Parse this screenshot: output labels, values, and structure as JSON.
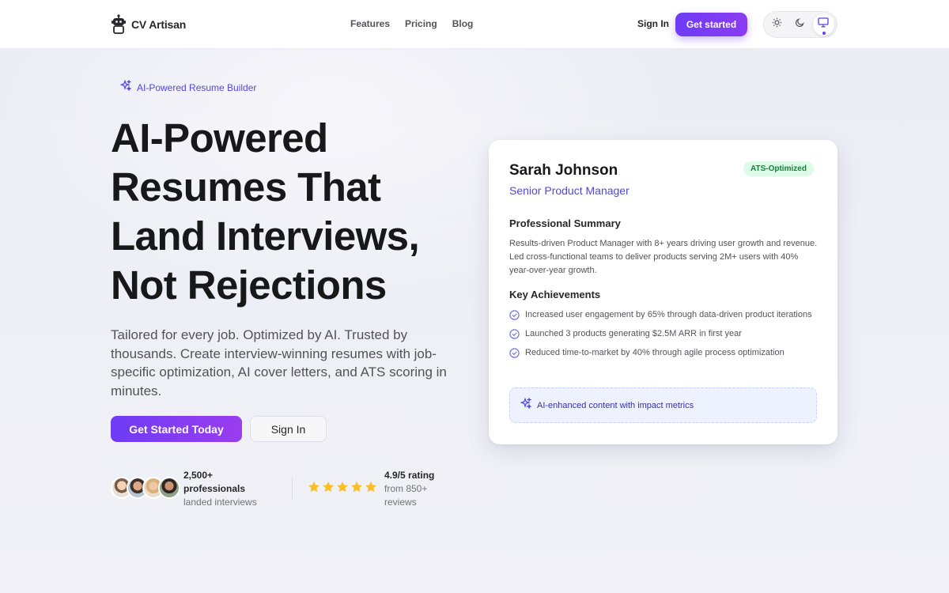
{
  "nav": {
    "logo_text": "CV Artisan",
    "links": [
      "Features",
      "Pricing",
      "Blog"
    ],
    "sign_in": "Sign In",
    "cta": "Get started",
    "theme_options": [
      "light",
      "dark",
      "system"
    ],
    "theme_selected": "system"
  },
  "hero": {
    "badge": "AI-Powered Resume Builder",
    "headline_lines": [
      "AI-Powered",
      "Resumes That",
      "Land Interviews,",
      "Not Rejections"
    ],
    "subtext": "Tailored for every job. Optimized by AI. Trusted by thousands. Create interview-winning resumes with job-specific optimization, AI cover letters, and ATS scoring in minutes.",
    "primary_button": "Get Started Today",
    "secondary_button": "Sign In",
    "social_proof": {
      "count": "2,500+",
      "count_label": "professionals",
      "count_sub": "landed interviews",
      "rating": "4.9/5 rating",
      "rating_sub1": "from 850+",
      "rating_sub2": "reviews",
      "stars": 5
    }
  },
  "resume_card": {
    "name": "Sarah Johnson",
    "role": "Senior Product Manager",
    "badge": "ATS-Optimized",
    "summary_heading": "Professional Summary",
    "summary": "Results-driven Product Manager with 8+ years driving user growth and revenue. Led cross-functional teams to deliver products serving 2M+ users with 40% year-over-year growth.",
    "achievements_heading": "Key Achievements",
    "achievements": [
      "Increased user engagement by 65% through data-driven product iterations",
      "Launched 3 products generating $2.5M ARR in first year",
      "Reduced time-to-market by 40% through agile process optimization"
    ],
    "ai_note": "AI-enhanced content with impact metrics"
  },
  "colors": {
    "accent": "#6d3cf5",
    "accent_text": "#4f46e5",
    "success_bg": "#dcfce7",
    "success_text": "#15803d",
    "star": "#fbbf24"
  }
}
